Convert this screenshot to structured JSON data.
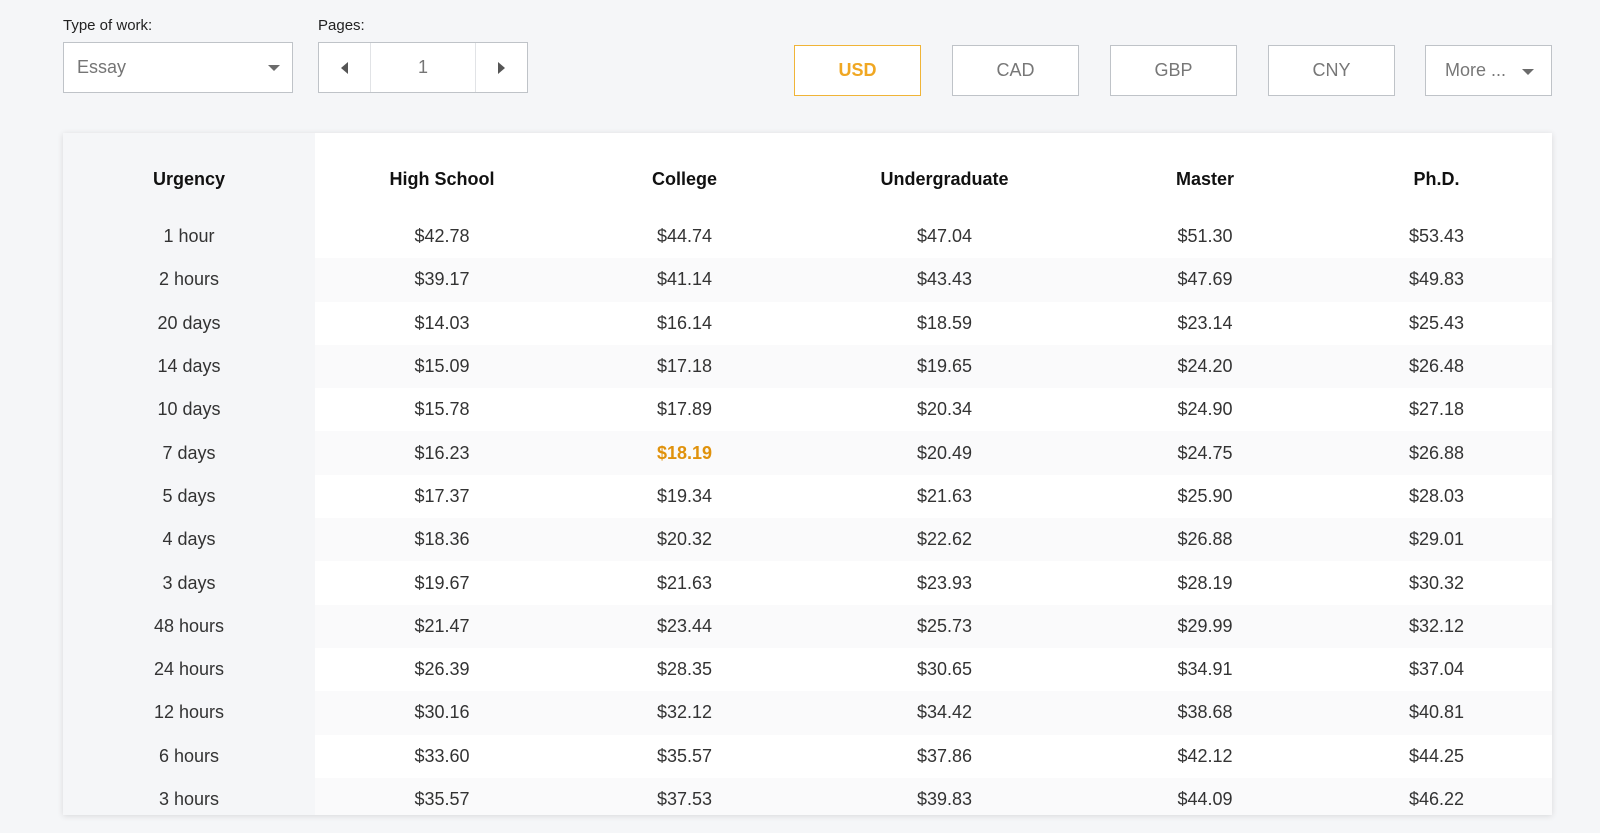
{
  "controls": {
    "type_of_work": {
      "label": "Type of work:",
      "value": "Essay"
    },
    "pages": {
      "label": "Pages:",
      "value": "1"
    }
  },
  "currencies": {
    "items": [
      "USD",
      "CAD",
      "GBP",
      "CNY"
    ],
    "more_label": "More ...",
    "active": "USD"
  },
  "accent_color": "#f0a722",
  "table": {
    "headers": [
      "Urgency",
      "High School",
      "College",
      "Undergraduate",
      "Master",
      "Ph.D."
    ],
    "rows": [
      [
        "1 hour",
        "$42.78",
        "$44.74",
        "$47.04",
        "$51.30",
        "$53.43"
      ],
      [
        "2 hours",
        "$39.17",
        "$41.14",
        "$43.43",
        "$47.69",
        "$49.83"
      ],
      [
        "20 days",
        "$14.03",
        "$16.14",
        "$18.59",
        "$23.14",
        "$25.43"
      ],
      [
        "14 days",
        "$15.09",
        "$17.18",
        "$19.65",
        "$24.20",
        "$26.48"
      ],
      [
        "10 days",
        "$15.78",
        "$17.89",
        "$20.34",
        "$24.90",
        "$27.18"
      ],
      [
        "7 days",
        "$16.23",
        "$18.19",
        "$20.49",
        "$24.75",
        "$26.88"
      ],
      [
        "5 days",
        "$17.37",
        "$19.34",
        "$21.63",
        "$25.90",
        "$28.03"
      ],
      [
        "4 days",
        "$18.36",
        "$20.32",
        "$22.62",
        "$26.88",
        "$29.01"
      ],
      [
        "3 days",
        "$19.67",
        "$21.63",
        "$23.93",
        "$28.19",
        "$30.32"
      ],
      [
        "48 hours",
        "$21.47",
        "$23.44",
        "$25.73",
        "$29.99",
        "$32.12"
      ],
      [
        "24 hours",
        "$26.39",
        "$28.35",
        "$30.65",
        "$34.91",
        "$37.04"
      ],
      [
        "12 hours",
        "$30.16",
        "$32.12",
        "$34.42",
        "$38.68",
        "$40.81"
      ],
      [
        "6 hours",
        "$33.60",
        "$35.57",
        "$37.86",
        "$42.12",
        "$44.25"
      ],
      [
        "3 hours",
        "$35.57",
        "$37.53",
        "$39.83",
        "$44.09",
        "$46.22"
      ]
    ],
    "highlighted_cell": {
      "row": 5,
      "col": 2
    }
  }
}
